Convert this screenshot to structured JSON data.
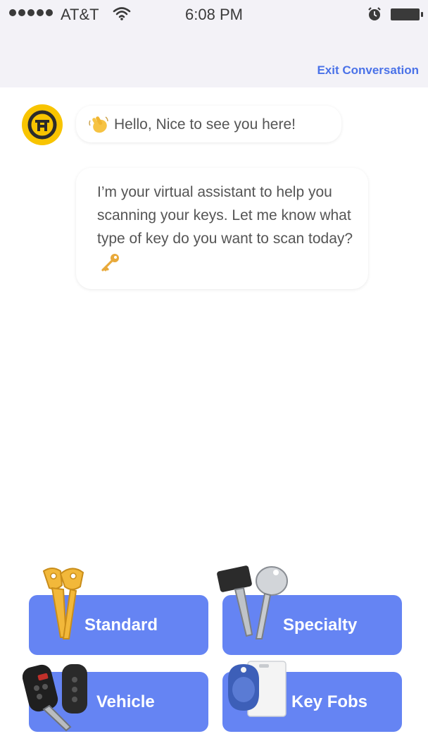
{
  "status_bar": {
    "carrier": "AT&T",
    "time": "6:08 PM",
    "icons": [
      "signal-dots-icon",
      "wifi-icon",
      "alarm-icon",
      "battery-icon"
    ]
  },
  "header": {
    "exit_label": "Exit Conversation"
  },
  "chat": {
    "greeting": "Hello, Nice to see you here!",
    "greeting_emoji": "waving-hand-icon",
    "message": "I’m your virtual assistant to help you scanning your keys. Let me know what type of key do you want to scan today?",
    "message_emoji": "key-icon"
  },
  "options": [
    {
      "label": "Standard",
      "icon": "standard-keys-icon"
    },
    {
      "label": "Specialty",
      "icon": "specialty-keys-icon"
    },
    {
      "label": "Vehicle",
      "icon": "vehicle-key-icon"
    },
    {
      "label": "Key Fobs",
      "icon": "key-fob-icon"
    }
  ],
  "colors": {
    "accent": "#6584f3",
    "link": "#4a72e8",
    "avatar": "#f8c400",
    "header_bg": "#f3f2f7"
  }
}
